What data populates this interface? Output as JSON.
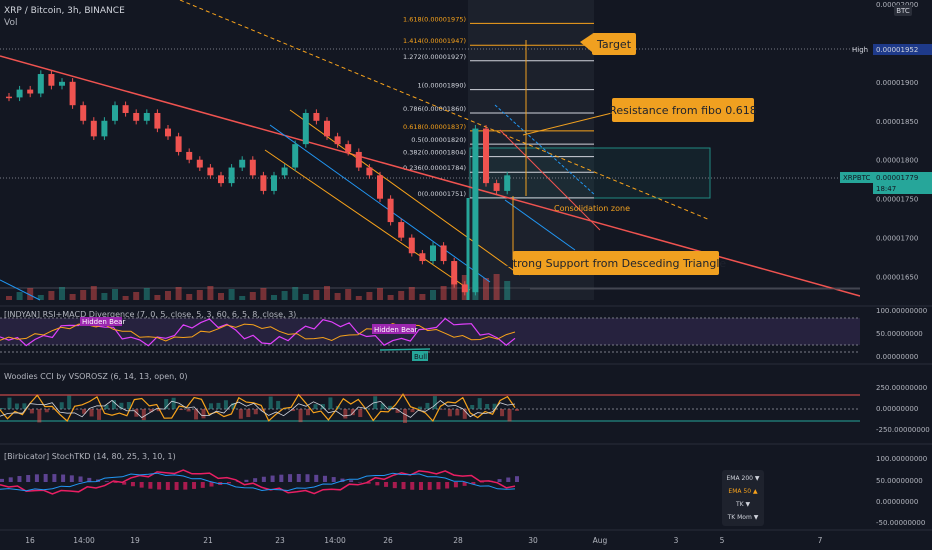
{
  "header": {
    "symbol_line": "XRP / Bitcoin, 3h, BINANCE",
    "vol_label": "Vol"
  },
  "badges": {
    "currency": "BTC",
    "high_label": "High",
    "high_value": "0.00001952",
    "ticker": "XRPBTC",
    "last_price": "0.00001779",
    "countdown": "18:47"
  },
  "indicators": {
    "rsi_macd": "[INDYAN] RSI+MACD Divergence (7, 0, 5, close, 5, 3, 60, 6, 5, 8, close, 3)",
    "cci": "Woodies CCI by VSOROSZ (6, 14, 13, open, 0)",
    "stoch": "[Birbicator] StochTKD (14, 80, 25, 3, 10, 1)"
  },
  "annotations": {
    "target": "Target",
    "resistance": "Resistance from fibo 0.618",
    "support": "Strong Support from Desceding Triangle",
    "consolidation": "Consolidation zone",
    "hidden_bear_1": "Hidden Bear",
    "hidden_bear_2": "Hidden Bear",
    "bull": "Bull"
  },
  "legend_box": {
    "ema200": "EMA 200 ▼",
    "ema50": "EMA 50 ▲",
    "tk": "TK ▼",
    "tkmom": "TK Mom ▼"
  },
  "colors": {
    "bull": "#26a69a",
    "bear": "#ef5350",
    "accent_orange": "#f7a21b",
    "callout": "#f0a020",
    "fib": "#d1d4dc",
    "magenta": "#e91e63",
    "purple": "#7e57c2",
    "background": "#131722"
  },
  "chart_data": {
    "type": "candlestick",
    "price_axis": {
      "ticks": [
        "0.00002000",
        "0.00001900",
        "0.00001850",
        "0.00001800",
        "0.00001750",
        "0.00001700",
        "0.00001650"
      ],
      "ylim": [
        1.62e-05,
        2.005e-05
      ]
    },
    "x_axis": {
      "ticks": [
        "16",
        "14:00",
        "19",
        "21",
        "23",
        "14:00",
        "26",
        "28",
        "30",
        "Aug",
        "3",
        "5",
        "7"
      ]
    },
    "fib_levels": [
      {
        "label": "1.618(0.00001975)",
        "value": 1.975e-05
      },
      {
        "label": "1.414(0.00001947)",
        "value": 1.947e-05
      },
      {
        "label": "1.272(0.00001927)",
        "value": 1.927e-05
      },
      {
        "label": "1(0.00001890)",
        "value": 1.89e-05
      },
      {
        "label": "0.786(0.00001860)",
        "value": 1.86e-05
      },
      {
        "label": "0.618(0.00001837)",
        "value": 1.837e-05
      },
      {
        "label": "0.5(0.00001820)",
        "value": 1.82e-05
      },
      {
        "label": "0.382(0.00001804)",
        "value": 1.804e-05
      },
      {
        "label": "0.236(0.00001784)",
        "value": 1.784e-05
      },
      {
        "label": "0(0.00001751)",
        "value": 1.751e-05
      }
    ],
    "close_series": [
      1.88e-05,
      1.89e-05,
      1.885e-05,
      1.91e-05,
      1.895e-05,
      1.9e-05,
      1.87e-05,
      1.85e-05,
      1.83e-05,
      1.85e-05,
      1.87e-05,
      1.86e-05,
      1.85e-05,
      1.86e-05,
      1.84e-05,
      1.83e-05,
      1.81e-05,
      1.8e-05,
      1.79e-05,
      1.78e-05,
      1.77e-05,
      1.79e-05,
      1.8e-05,
      1.78e-05,
      1.76e-05,
      1.78e-05,
      1.79e-05,
      1.82e-05,
      1.86e-05,
      1.85e-05,
      1.83e-05,
      1.82e-05,
      1.81e-05,
      1.79e-05,
      1.78e-05,
      1.75e-05,
      1.72e-05,
      1.7e-05,
      1.68e-05,
      1.67e-05,
      1.69e-05,
      1.67e-05,
      1.64e-05,
      1.63e-05,
      1.84e-05,
      1.77e-05,
      1.76e-05,
      1.78e-05
    ],
    "rsi_axis": [
      "100.00000000",
      "50.00000000",
      "0.00000000"
    ],
    "cci_axis": [
      "250.00000000",
      "0.00000000",
      "-250.00000000"
    ],
    "stoch_axis": [
      "100.00000000",
      "50.00000000",
      "0.00000000",
      "-50.00000000"
    ]
  }
}
